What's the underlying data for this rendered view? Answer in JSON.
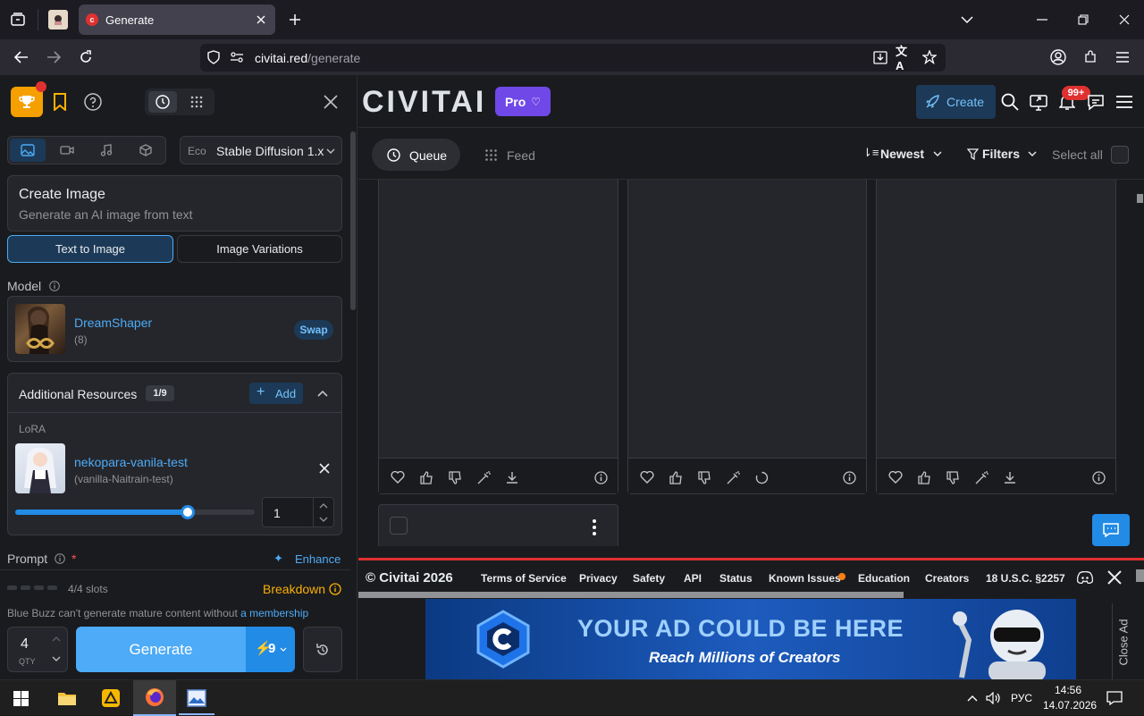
{
  "browser": {
    "tab_title": "Generate",
    "url_host": "civitai.red",
    "url_path": "/generate"
  },
  "left": {
    "model_selector": {
      "prefix": "Eco",
      "value": "Stable Diffusion 1.x"
    },
    "create": {
      "title": "Create Image",
      "subtitle": "Generate an AI image from text"
    },
    "mode_tabs": [
      {
        "label": "Text to Image"
      },
      {
        "label": "Image Variations"
      }
    ],
    "model_label": "Model",
    "model": {
      "name": "DreamShaper",
      "count": "(8)",
      "swap": "Swap"
    },
    "additional": {
      "title": "Additional Resources",
      "badge": "1/9",
      "add": "Add",
      "section": "LoRA"
    },
    "lora": {
      "name": "nekopara-vanila-test",
      "sub": "(vanilla-Naitrain-test)",
      "strength": "1",
      "slider": 0.72
    },
    "prompt_label": "Prompt",
    "prompt_required": "*",
    "enhance": "Enhance",
    "slots": "4/4 slots",
    "breakdown": "Breakdown",
    "notice": "Blue Buzz can't generate mature content without",
    "notice_link": "a membership",
    "qty": {
      "value": "4",
      "label": "QTY"
    },
    "generate": "Generate",
    "cost": "9"
  },
  "header": {
    "logo": "CIVITAI",
    "pro": "Pro",
    "create": "Create",
    "notif_badge": "99+"
  },
  "toolbar": {
    "queue": "Queue",
    "feed": "Feed",
    "sort": "Newest",
    "filters": "Filters",
    "select_all": "Select all"
  },
  "footer": {
    "copyright": "© Civitai 2026",
    "links": [
      "Terms of Service",
      "Privacy",
      "Safety",
      "API",
      "Status",
      "Known Issues",
      "Education",
      "Creators",
      "18 U.S.C. §2257"
    ]
  },
  "ad": {
    "headline": "YOUR AD COULD BE HERE",
    "sub": "Reach Millions of Creators",
    "close": "Close Ad"
  },
  "taskbar": {
    "lang": "РУС",
    "time": "14:56",
    "date": "14.07.2026"
  },
  "colors": {
    "accent": "#4dabf7",
    "pro": "#7048e8",
    "brand_red": "#e03131",
    "generate": "#4dabf7"
  }
}
